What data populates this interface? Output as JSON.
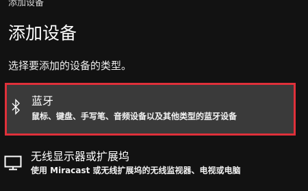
{
  "window": {
    "title": "添加设备"
  },
  "header": {
    "title": "添加设备",
    "subtitle": "选择要添加的设备的类型。"
  },
  "options": [
    {
      "icon": "bluetooth-icon",
      "title": "蓝牙",
      "description": "鼠标、键盘、手写笔、音频设备以及其他类型的蓝牙设备",
      "highlighted": true,
      "highlight_color": "#e0303a"
    },
    {
      "icon": "monitor-icon",
      "title": "无线显示器或扩展坞",
      "description": "使用 Miracast 或无线扩展坞的无线监视器、电视或电脑",
      "highlighted": false
    }
  ]
}
